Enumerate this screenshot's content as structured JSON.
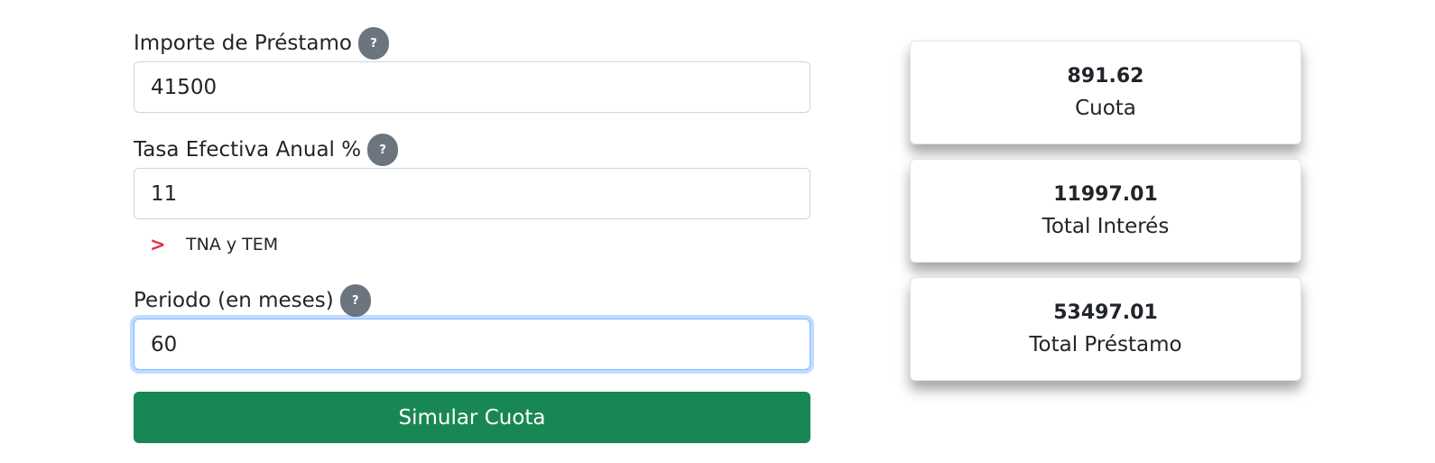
{
  "form": {
    "loan_amount": {
      "label": "Importe de Préstamo",
      "help": "?",
      "value": "41500"
    },
    "annual_rate": {
      "label": "Tasa Efectiva Anual %",
      "help": "?",
      "value": "11"
    },
    "rate_toggle": {
      "chevron": ">",
      "label": "TNA y TEM"
    },
    "period": {
      "label": "Periodo (en meses)",
      "help": "?",
      "value": "60"
    },
    "submit_label": "Simular Cuota"
  },
  "results": [
    {
      "value": "891.62",
      "label": "Cuota"
    },
    {
      "value": "11997.01",
      "label": "Total Interés"
    },
    {
      "value": "53497.01",
      "label": "Total Préstamo"
    }
  ],
  "colors": {
    "primary_button": "#198754",
    "help_badge": "#6c757d",
    "chevron": "#dc3545",
    "focus_border": "#86b7fe"
  }
}
